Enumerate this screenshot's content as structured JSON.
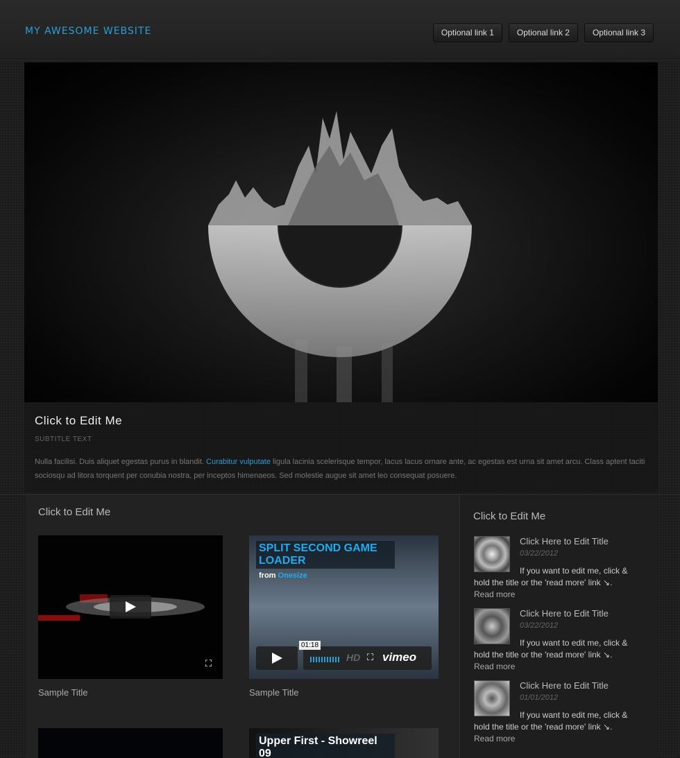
{
  "header": {
    "site_title": "MY AWESOME WEBSITE",
    "nav": [
      "Optional link 1",
      "Optional link 2",
      "Optional link 3"
    ]
  },
  "hero": {
    "title": "Click to Edit Me",
    "subtitle": "SUBTITLE TEXT",
    "body_before": "Nulla facilisi. Duis aliquet egestas purus in blandit. ",
    "body_link": "Curabitur vulputate",
    "body_after": " ligula lacinia scelerisque tempor, lacus lacus ornare ante, ac egestas est urna sit amet arcu. Class aptent taciti sociosqu ad litora torquent per conubia nostra, per inceptos himenaeos. Sed molestie augue sit amet leo consequat posuere."
  },
  "main": {
    "title": "Click to Edit Me",
    "videos": [
      {
        "title": "Sample Title"
      },
      {
        "title": "Sample Title",
        "overlay_title": "SPLIT SECOND GAME LOADER",
        "from_label": "from",
        "from_name": "Onesize",
        "time": "01:18",
        "hd": "HD",
        "brand": "vimeo"
      },
      {
        "title": ""
      },
      {
        "title": "",
        "overlay_title": "Upper First - Showreel 09"
      }
    ]
  },
  "sidebar": {
    "title": "Click to Edit Me",
    "posts": [
      {
        "title": "Click Here to Edit Title",
        "date": "03/22/2012",
        "text": "If you want to edit me, click & hold the title or the 'read more' link ↘.",
        "more": "Read more"
      },
      {
        "title": "Click Here to Edit Title",
        "date": "03/22/2012",
        "text": "If you want to edit me, click & hold the title or the 'read more' link ↘.",
        "more": "Read more"
      },
      {
        "title": "Click Here to Edit Title",
        "date": "01/01/2012",
        "text": "If you want to edit me, click & hold the title or the 'read more' link ↘.",
        "more": "Read more"
      }
    ]
  },
  "colors": {
    "accent": "#2a9fd6",
    "background": "#1c1c1c"
  }
}
